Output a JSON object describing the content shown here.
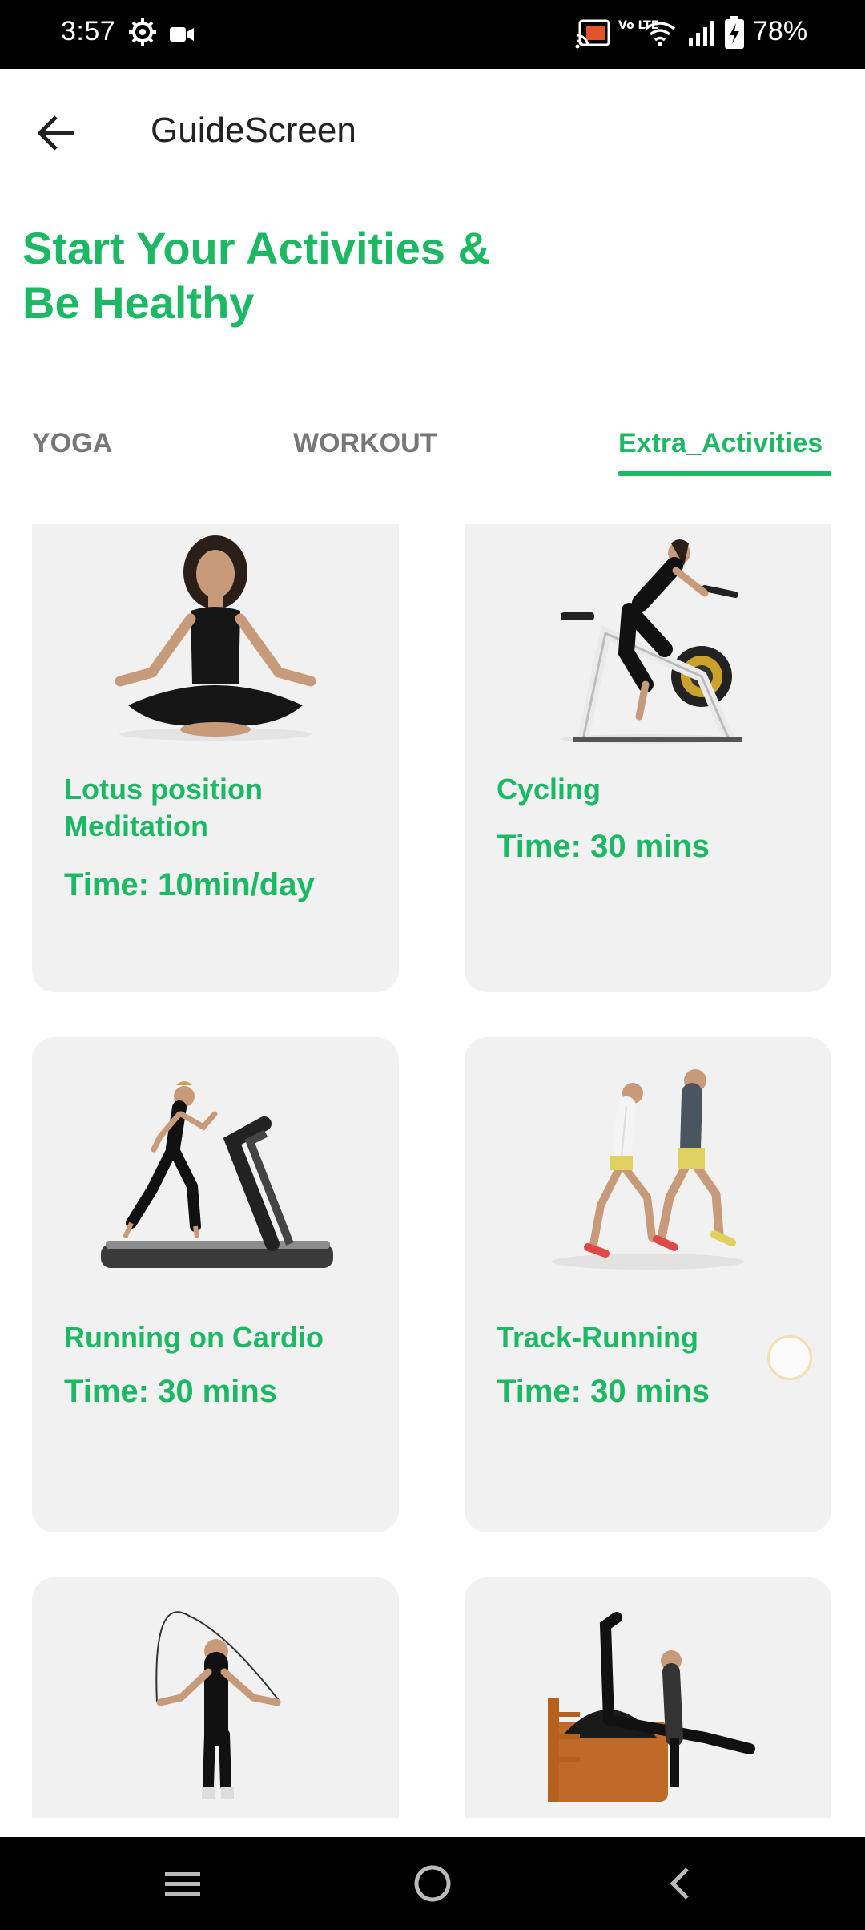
{
  "status_bar": {
    "time": "3:57",
    "volte_text": "Vo LTE",
    "battery_percent": "78%",
    "icons": [
      "settings-gear-icon",
      "video-camera-icon",
      "cast-icon",
      "volte-icon",
      "wifi-icon",
      "signal-icon",
      "battery-charging-icon"
    ]
  },
  "app_bar": {
    "title": "GuideScreen",
    "back_icon": "arrow-left-icon"
  },
  "headline": "Start Your Activities &\n Be Healthy",
  "tabs": [
    {
      "label": "YOGA",
      "selected": false
    },
    {
      "label": "WORKOUT",
      "selected": false
    },
    {
      "label": "Extra_Activities",
      "selected": true
    }
  ],
  "activities": [
    {
      "name": "Lotus position\nMeditation",
      "time": "Time: 10min/day",
      "image": "meditation-image"
    },
    {
      "name": "Cycling",
      "time": "Time: 30 mins",
      "image": "cycling-image"
    },
    {
      "name": "Running on Cardio",
      "time": "Time: 30 mins",
      "image": "treadmill-image"
    },
    {
      "name": "Track-Running",
      "time": "Time: 30 mins",
      "image": "track-running-image"
    },
    {
      "name": "",
      "time": "",
      "image": "jump-rope-image"
    },
    {
      "name": "",
      "time": "",
      "image": "pilates-image"
    }
  ],
  "colors": {
    "accent": "#1cb864",
    "tab_inactive": "#777777",
    "card_bg": "#f1f1f1",
    "status_bar_bg": "#000000"
  },
  "nav_bar": {
    "icons": [
      "menu-icon",
      "home-circle-icon",
      "back-chevron-icon"
    ]
  }
}
